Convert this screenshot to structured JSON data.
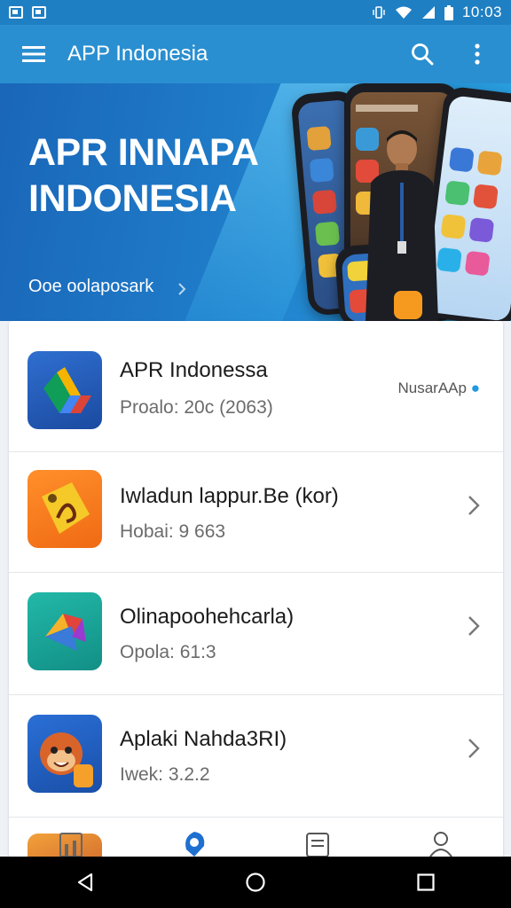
{
  "status_bar": {
    "time": "10:03"
  },
  "app_bar": {
    "title": "APP Indonesia"
  },
  "banner": {
    "title_line1": "APR INNAPA",
    "title_line2": "INDONESIA",
    "subtitle": "Ooe oolaposark"
  },
  "apps": [
    {
      "title": "APR Indonessa",
      "subtitle": "Proalo: 20ϲ (2063)",
      "badge": "NusarAAp"
    },
    {
      "title": "Iwladun lappur.Be (kor)",
      "subtitle": "Hobai: 9 663"
    },
    {
      "title": "Olinapoohehcarla)",
      "subtitle": "Opola: 61:3"
    },
    {
      "title": "Aplaki Nahda3RI)",
      "subtitle": "Iwek: 3.2.2"
    }
  ],
  "colors": {
    "app_bar": "#2a8fd0",
    "status_bar": "#1f7fc3",
    "banner": "#1f7cc9",
    "accent": "#1e9ae0"
  }
}
